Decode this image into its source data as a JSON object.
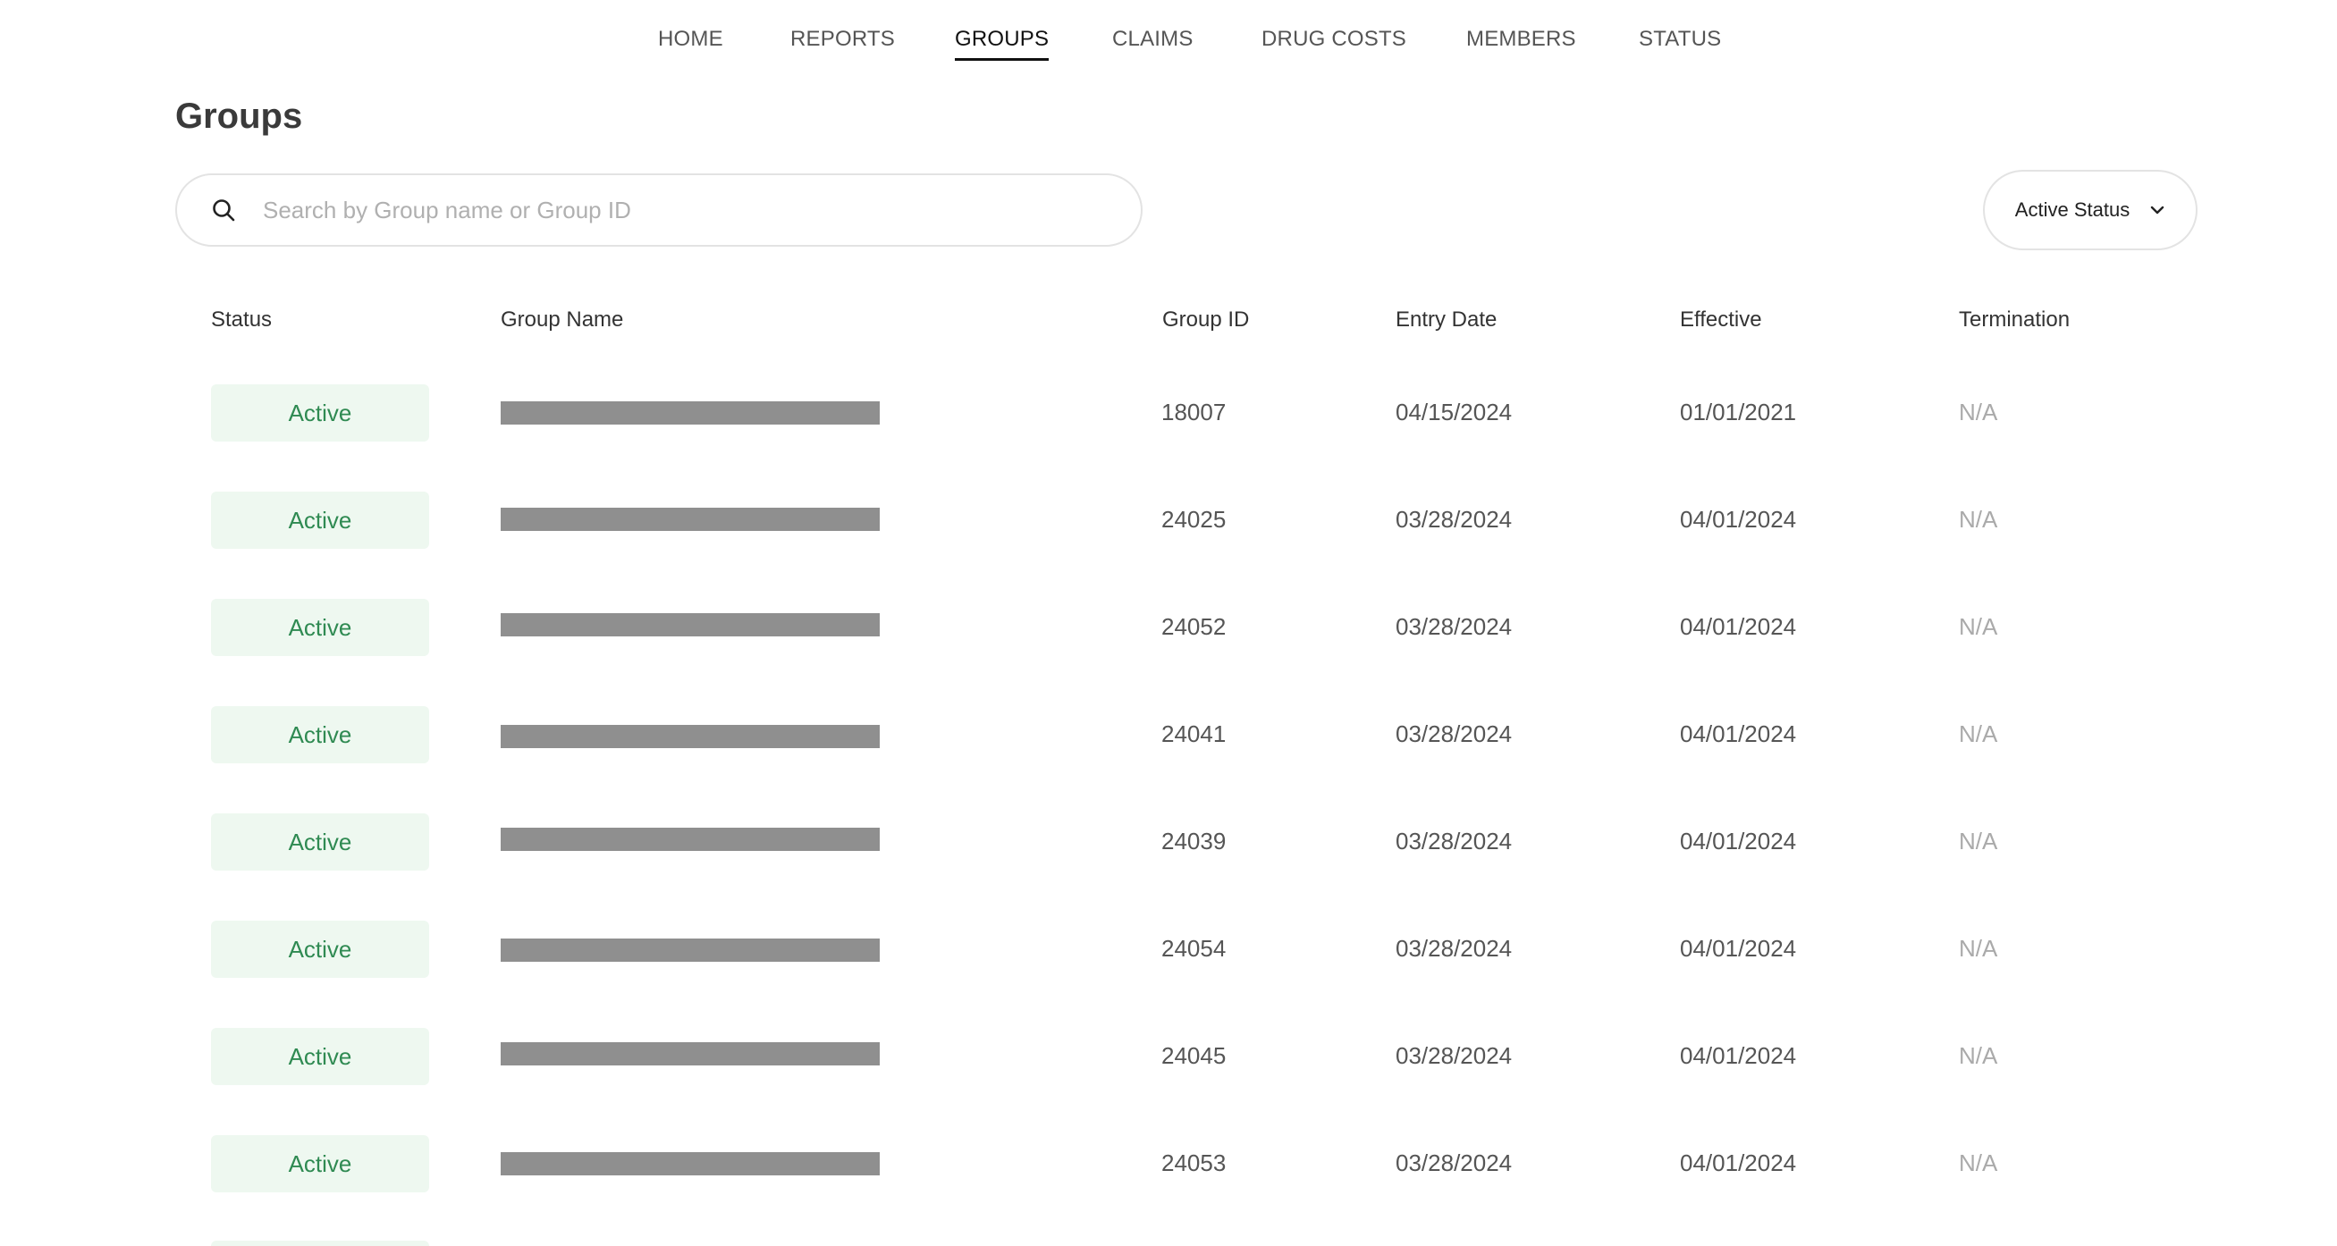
{
  "nav": {
    "items": [
      {
        "label": "HOME",
        "name": "nav-home"
      },
      {
        "label": "REPORTS",
        "name": "nav-reports"
      },
      {
        "label": "GROUPS",
        "name": "nav-groups",
        "active": true
      },
      {
        "label": "CLAIMS",
        "name": "nav-claims"
      },
      {
        "label": "DRUG COSTS",
        "name": "nav-drug-costs"
      },
      {
        "label": "MEMBERS",
        "name": "nav-members"
      },
      {
        "label": "STATUS",
        "name": "nav-status"
      }
    ]
  },
  "page": {
    "title": "Groups"
  },
  "search": {
    "icon": "search-icon",
    "placeholder": "Search by Group name or Group ID",
    "value": ""
  },
  "filter": {
    "label": "Active Status",
    "icon": "chevron-down-icon"
  },
  "table": {
    "columns": [
      "Status",
      "Group Name",
      "Group ID",
      "Entry Date",
      "Effective",
      "Termination"
    ],
    "rows": [
      {
        "status": "Active",
        "group_id": "18007",
        "entry_date": "04/15/2024",
        "effective": "01/01/2021",
        "termination": "N/A"
      },
      {
        "status": "Active",
        "group_id": "24025",
        "entry_date": "03/28/2024",
        "effective": "04/01/2024",
        "termination": "N/A"
      },
      {
        "status": "Active",
        "group_id": "24052",
        "entry_date": "03/28/2024",
        "effective": "04/01/2024",
        "termination": "N/A"
      },
      {
        "status": "Active",
        "group_id": "24041",
        "entry_date": "03/28/2024",
        "effective": "04/01/2024",
        "termination": "N/A"
      },
      {
        "status": "Active",
        "group_id": "24039",
        "entry_date": "03/28/2024",
        "effective": "04/01/2024",
        "termination": "N/A"
      },
      {
        "status": "Active",
        "group_id": "24054",
        "entry_date": "03/28/2024",
        "effective": "04/01/2024",
        "termination": "N/A"
      },
      {
        "status": "Active",
        "group_id": "24045",
        "entry_date": "03/28/2024",
        "effective": "04/01/2024",
        "termination": "N/A"
      },
      {
        "status": "Active",
        "group_id": "24053",
        "entry_date": "03/28/2024",
        "effective": "04/01/2024",
        "termination": "N/A"
      }
    ]
  },
  "colors": {
    "active_badge_bg": "#eef8f0",
    "active_badge_text": "#2f8a52",
    "redaction": "#8f8f8f"
  }
}
